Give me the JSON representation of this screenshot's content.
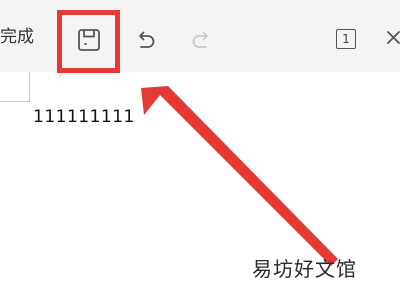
{
  "toolbar": {
    "done_label": "完成",
    "icons": {
      "save": "save-icon",
      "undo": "undo-icon",
      "redo": "redo-icon",
      "page": "page-icon",
      "close": "close-icon"
    },
    "redo_disabled": true,
    "page_number": "1"
  },
  "sheet": {
    "cell_value": "111111111"
  },
  "annotation": {
    "arrow_color": "#e53935",
    "highlight_color": "#e53935"
  },
  "watermark": {
    "text": "易坊好文馆"
  }
}
